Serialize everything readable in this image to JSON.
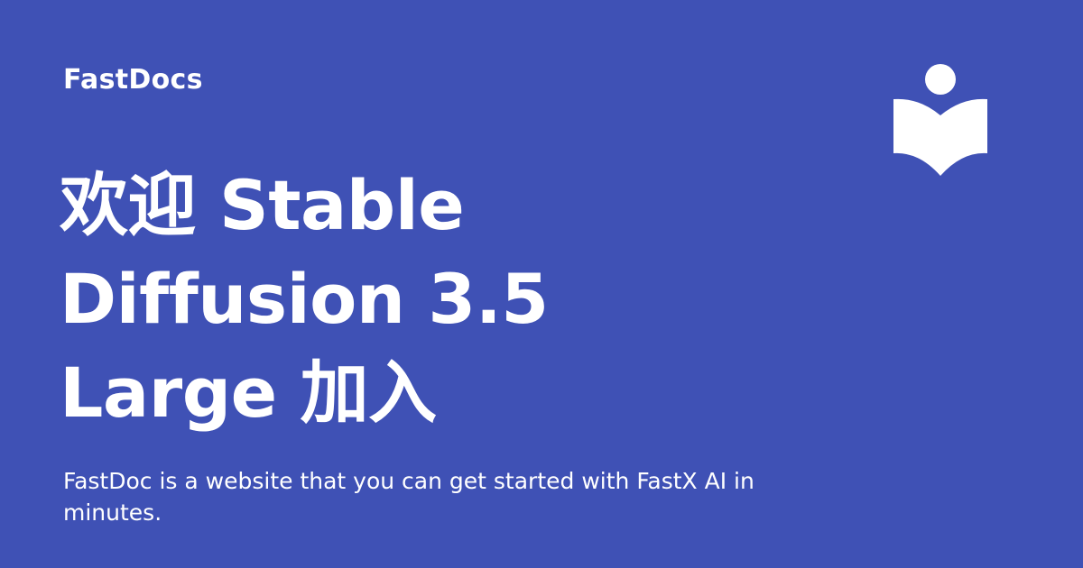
{
  "site": {
    "name": "FastDocs",
    "logo_icon": "open-book-reader-icon"
  },
  "headline": "欢迎 Stable Diffusion 3.5 Large 加入",
  "description": "FastDoc is a website that you can get started with FastX AI in minutes.",
  "colors": {
    "background": "#3f51b5",
    "text": "#ffffff"
  }
}
